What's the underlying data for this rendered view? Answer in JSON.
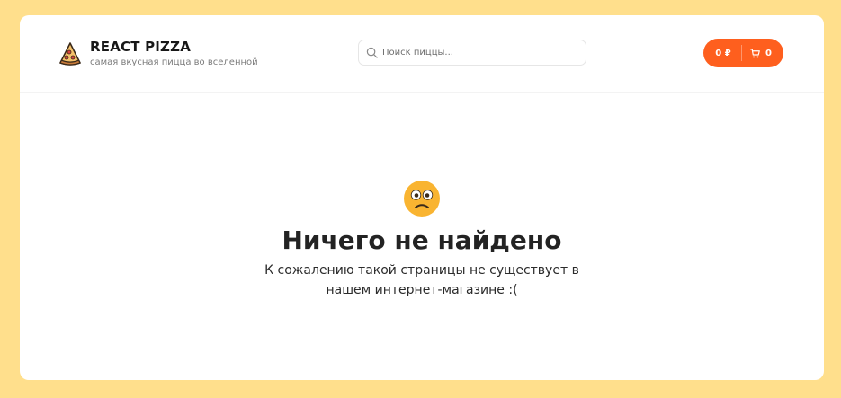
{
  "header": {
    "logo": {
      "icon": "pizza-icon",
      "title": "REACT PIZZA",
      "subtitle": "самая вкусная пицца во вселенной"
    },
    "search": {
      "icon": "search-icon",
      "placeholder": "Поиск пиццы...",
      "value": ""
    },
    "cart": {
      "price": "0 ₽",
      "count": "0",
      "icon": "cart-icon",
      "color": "#FE5F1E"
    }
  },
  "empty": {
    "icon": "confused-face-icon",
    "title": "Ничего не найдено",
    "text_line1": "К сожалению такой страницы не существует в",
    "text_line2": "нашем интернет-магазине :("
  },
  "colors": {
    "page_background": "#FFDF8C",
    "accent": "#FE5F1E"
  }
}
